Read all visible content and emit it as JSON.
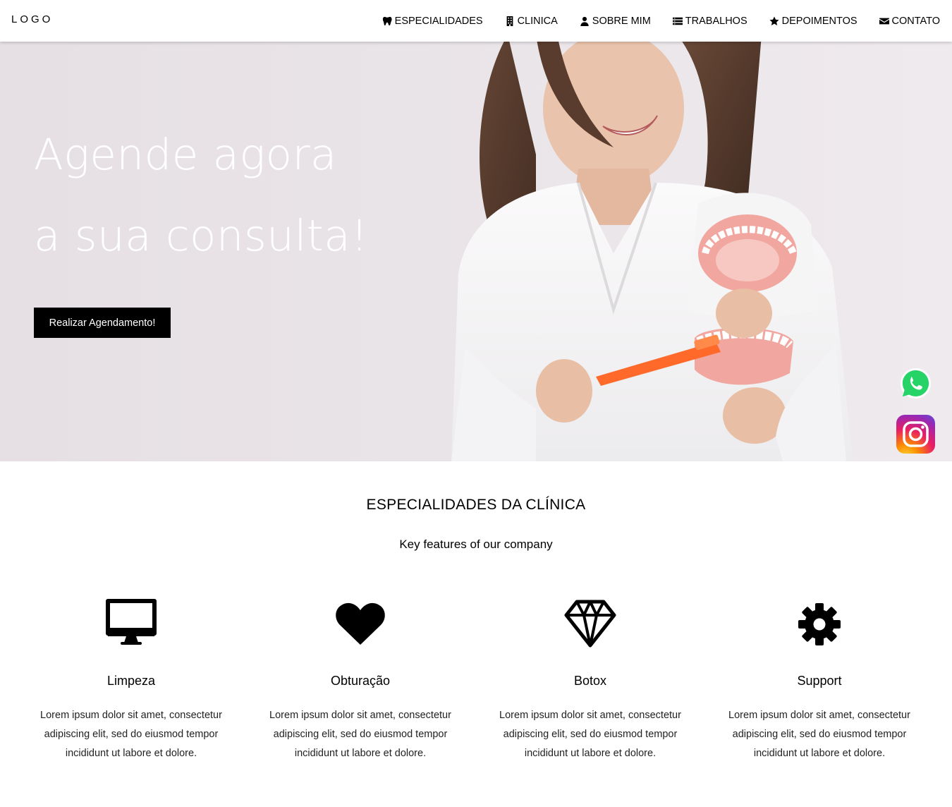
{
  "navbar": {
    "logo": "LOGO",
    "items": [
      {
        "label": "ESPECIALIDADES",
        "icon": "tooth-icon"
      },
      {
        "label": "CLINICA",
        "icon": "building-icon"
      },
      {
        "label": "SOBRE MIM",
        "icon": "user-icon"
      },
      {
        "label": "TRABALHOS",
        "icon": "list-icon"
      },
      {
        "label": "DEPOIMENTOS",
        "icon": "star-icon"
      },
      {
        "label": "CONTATO",
        "icon": "envelope-icon"
      }
    ]
  },
  "hero": {
    "line1": "Agende agora",
    "line2": "a sua consulta!",
    "button": "Realizar Agendamento!"
  },
  "social": {
    "whatsapp_icon": "whatsapp-icon",
    "instagram_icon": "instagram-icon"
  },
  "features": {
    "title": "ESPECIALIDADES DA CLÍNICA",
    "subtitle": "Key features of our company",
    "items": [
      {
        "icon": "desktop-icon",
        "title": "Limpeza",
        "text": "Lorem ipsum dolor sit amet, consectetur adipiscing elit, sed do eiusmod tempor incididunt ut labore et dolore."
      },
      {
        "icon": "heart-icon",
        "title": "Obturação",
        "text": "Lorem ipsum dolor sit amet, consectetur adipiscing elit, sed do eiusmod tempor incididunt ut labore et dolore."
      },
      {
        "icon": "diamond-icon",
        "title": "Botox",
        "text": "Lorem ipsum dolor sit amet, consectetur adipiscing elit, sed do eiusmod tempor incididunt ut labore et dolore."
      },
      {
        "icon": "gear-icon",
        "title": "Support",
        "text": "Lorem ipsum dolor sit amet, consectetur adipiscing elit, sed do eiusmod tempor incididunt ut labore et dolore."
      }
    ]
  },
  "colors": {
    "accent": "#000000",
    "hero_bg": "#e9e4e8",
    "whatsapp": "#25d366"
  }
}
